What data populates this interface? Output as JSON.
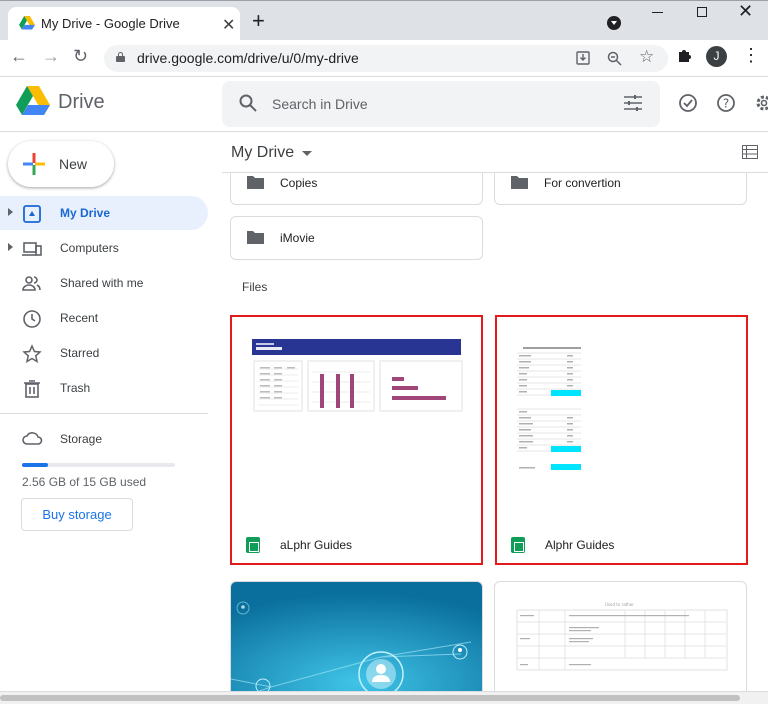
{
  "browser": {
    "tab_title": "My Drive - Google Drive",
    "url": "drive.google.com/drive/u/0/my-drive",
    "avatar_initial": "J"
  },
  "app": {
    "name": "Drive",
    "search_placeholder": "Search in Drive"
  },
  "sidebar": {
    "new_label": "New",
    "items": [
      {
        "label": "My Drive",
        "icon": "my-drive-icon",
        "active": true,
        "expandable": true
      },
      {
        "label": "Computers",
        "icon": "computers-icon",
        "active": false,
        "expandable": true
      },
      {
        "label": "Shared with me",
        "icon": "shared-icon",
        "active": false,
        "expandable": false
      },
      {
        "label": "Recent",
        "icon": "clock-icon",
        "active": false,
        "expandable": false
      },
      {
        "label": "Starred",
        "icon": "star-icon",
        "active": false,
        "expandable": false
      },
      {
        "label": "Trash",
        "icon": "trash-icon",
        "active": false,
        "expandable": false
      }
    ],
    "storage": {
      "label": "Storage",
      "used_text": "2.56 GB of 15 GB used",
      "used_fraction": 0.17,
      "buy_label": "Buy storage"
    }
  },
  "main": {
    "breadcrumb": "My Drive",
    "folders": [
      {
        "name": "Copies"
      },
      {
        "name": "For convertion"
      },
      {
        "name": "iMovie"
      }
    ],
    "files_label": "Files",
    "files": [
      {
        "name": "aLphr Guides",
        "type": "sheets",
        "highlighted": true
      },
      {
        "name": "Alphr Guides",
        "type": "sheets",
        "highlighted": true
      }
    ],
    "preview_doc_title": "Used to rather"
  },
  "colors": {
    "accent": "#1a73e8",
    "active_nav_bg": "#e8f0fe",
    "highlight_border": "#e31b1b",
    "sheets_green": "#0f9d58"
  }
}
